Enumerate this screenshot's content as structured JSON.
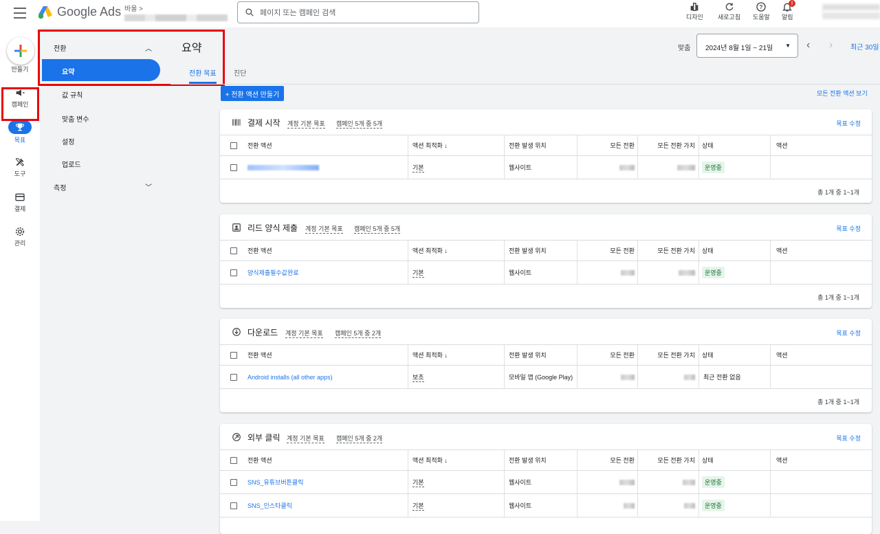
{
  "app": {
    "logo_text": "Google Ads",
    "breadcrumb": "바울 >",
    "search_placeholder": "페이지 또는 캠페인 검색"
  },
  "top_icons": [
    {
      "name": "design-icon",
      "label": "디자인"
    },
    {
      "name": "refresh-icon",
      "label": "새로고침"
    },
    {
      "name": "help-icon",
      "label": "도움말"
    },
    {
      "name": "bell-icon",
      "label": "알림",
      "badge": "!"
    }
  ],
  "left_nav": {
    "create": "만들기",
    "campaigns": "캠페인",
    "goals": "목표",
    "tools": "도구",
    "billing": "결제",
    "admin": "관리"
  },
  "sub_nav": {
    "section": "전환",
    "active": "요약",
    "items": [
      "값 규칙",
      "맞춤 변수",
      "설정",
      "업로드"
    ],
    "measure": "측정"
  },
  "page": {
    "title": "요약",
    "tabs": [
      "전환 목표",
      "진단"
    ],
    "date_label": "맞춤",
    "date_range": "2024년 8월 1일 ~ 21일",
    "recent": "최근 30일",
    "create_action": "+ 전환 액션 만들기",
    "view_all": "모든 전환 액션 보기"
  },
  "columns": [
    "전환 액션",
    "액션 최적화 ↓",
    "전환 발생 위치",
    "모든 전환",
    "모든 전환 가치",
    "상태",
    "액션"
  ],
  "cards": [
    {
      "title": "결제 시작",
      "sub1": "계정 기본 목표",
      "sub2": "캠페인 5개 중 5개",
      "edit": "목표 수정",
      "rows": [
        {
          "action": "",
          "opt": "기본",
          "source": "웹사이트",
          "status": "운영중"
        }
      ],
      "footer": "총 1개 중 1~1개"
    },
    {
      "title": "리드 양식 제출",
      "sub1": "계정 기본 목표",
      "sub2": "캠페인 5개 중 5개",
      "edit": "목표 수정",
      "rows": [
        {
          "action": "양식제출필수값완료",
          "opt": "기본",
          "source": "웹사이트",
          "status": "운영중"
        }
      ],
      "footer": "총 1개 중 1~1개"
    },
    {
      "title": "다운로드",
      "sub1": "계정 기본 목표",
      "sub2": "캠페인 5개 중 2개",
      "edit": "목표 수정",
      "rows": [
        {
          "action": "Android installs (all other apps)",
          "opt": "보조",
          "source": "모바일 앱 (Google Play)",
          "status": "최근 전환 없음"
        }
      ],
      "footer": "총 1개 중 1~1개"
    },
    {
      "title": "외부 클릭",
      "sub1": "계정 기본 목표",
      "sub2": "캠페인 5개 중 2개",
      "edit": "목표 수정",
      "rows": [
        {
          "action": "SNS_유튜브버튼클릭",
          "opt": "기본",
          "source": "웹사이트",
          "status": "운영중"
        },
        {
          "action": "SNS_인스타클릭",
          "opt": "기본",
          "source": "웹사이트",
          "status": "운영중"
        }
      ],
      "footer": ""
    }
  ]
}
